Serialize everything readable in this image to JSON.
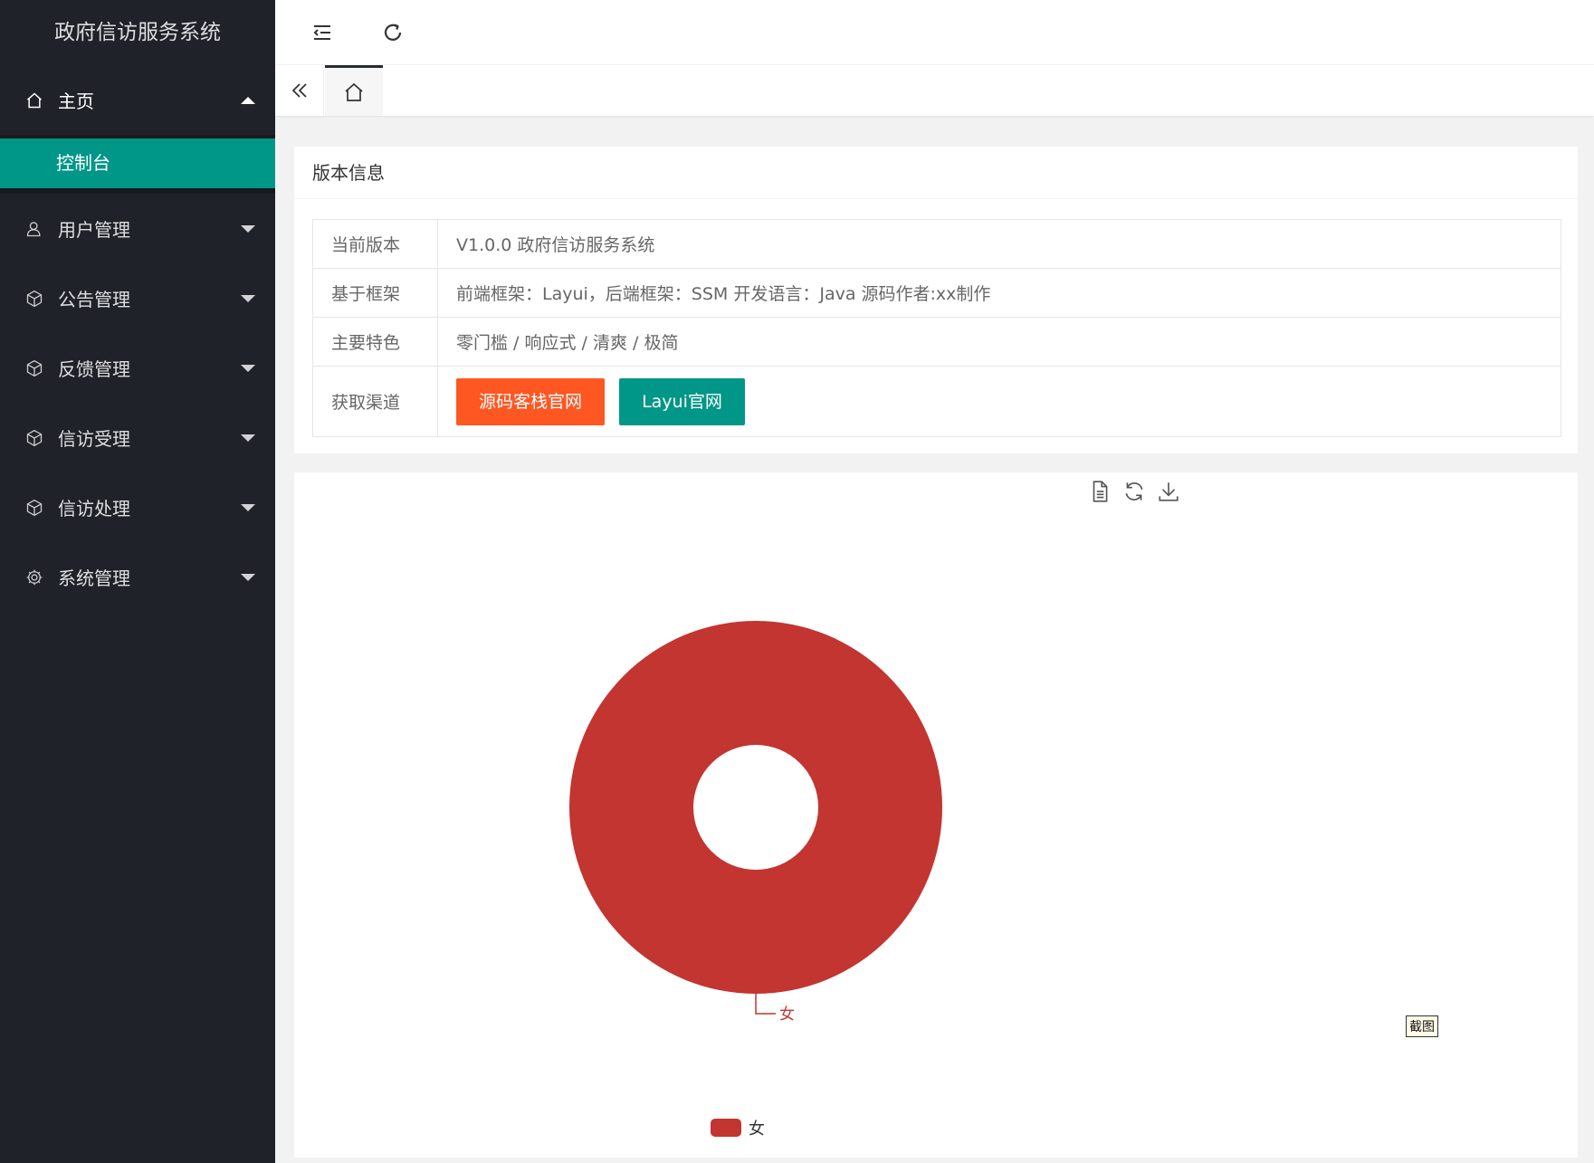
{
  "app": {
    "title": "政府信访服务系统"
  },
  "sidebar": {
    "items": [
      {
        "label": "主页",
        "icon": "home-icon",
        "open": true,
        "children": [
          {
            "label": "控制台",
            "active": true
          }
        ]
      },
      {
        "label": "用户管理",
        "icon": "user-icon"
      },
      {
        "label": "公告管理",
        "icon": "cube-icon"
      },
      {
        "label": "反馈管理",
        "icon": "cube-icon"
      },
      {
        "label": "信访受理",
        "icon": "cube-icon"
      },
      {
        "label": "信访处理",
        "icon": "cube-icon"
      },
      {
        "label": "系统管理",
        "icon": "gear-icon"
      }
    ]
  },
  "version_card": {
    "title": "版本信息",
    "rows": [
      {
        "key": "当前版本",
        "value": "V1.0.0 政府信访服务系统"
      },
      {
        "key": "基于框架",
        "value": "前端框架：Layui，后端框架：SSM 开发语言：Java 源码作者:xx制作"
      },
      {
        "key": "主要特色",
        "value": "零门槛 / 响应式 / 清爽 / 极简"
      },
      {
        "key": "获取渠道",
        "buttons": [
          "源码客栈官网",
          "Layui官网"
        ]
      }
    ]
  },
  "chart_tooltip": "截图",
  "colors": {
    "sidebar_bg": "#20222a",
    "accent": "#009688",
    "orange": "#ff5722",
    "series_red": "#c23531"
  },
  "chart_data": {
    "type": "pie",
    "variant": "donut",
    "slices": [
      {
        "name": "女",
        "value": 1,
        "color": "#c23531"
      }
    ],
    "legend": [
      "女"
    ],
    "legend_position": "bottom-center"
  }
}
